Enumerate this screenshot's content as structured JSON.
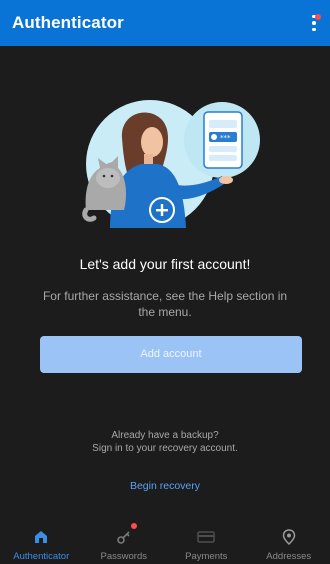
{
  "header": {
    "title": "Authenticator",
    "menu_icon": "more-vertical-icon"
  },
  "onboarding": {
    "heading": "Let's add your first account!",
    "subtext": "For further assistance, see the Help section in the menu.",
    "add_account_label": "Add account",
    "backup_line1": "Already have a backup?",
    "backup_line2": "Sign in to your recovery account.",
    "recovery_link": "Begin recovery"
  },
  "bottom_nav": [
    {
      "label": "Authenticator",
      "icon": "home-icon",
      "active": true
    },
    {
      "label": "Passwords",
      "icon": "key-icon",
      "active": false,
      "badge": true
    },
    {
      "label": "Payments",
      "icon": "card-icon",
      "active": false
    },
    {
      "label": "Addresses",
      "icon": "location-pin-icon",
      "active": false
    }
  ],
  "colors": {
    "app_bar": "#0a74d6",
    "background": "#1c1c1c",
    "button": "#9cc3f5",
    "link": "#5aa2f2",
    "active_nav": "#3a8ee6",
    "badge": "#ff4b4b"
  }
}
